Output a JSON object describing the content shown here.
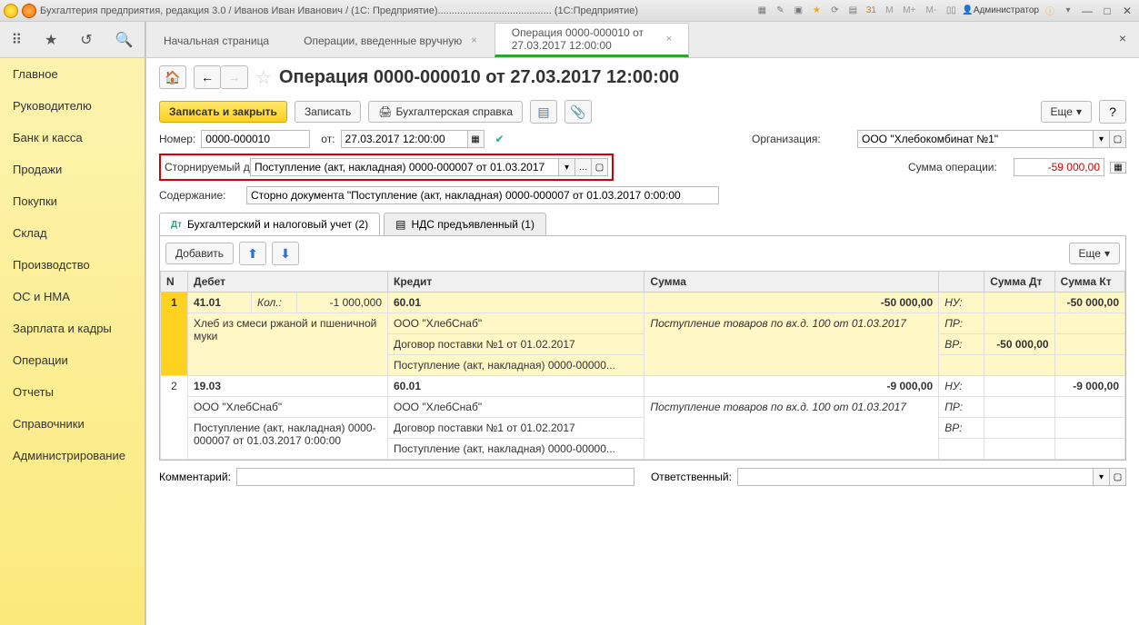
{
  "app": {
    "title": "Бухгалтерия предприятия, редакция 3.0 / Иванов Иван Иванович / (1С: Предприятие)......................................... (1С:Предприятие)",
    "user": "Администратор",
    "m_labels": [
      "M",
      "M+",
      "M-"
    ]
  },
  "sidebar": [
    "Главное",
    "Руководителю",
    "Банк и касса",
    "Продажи",
    "Покупки",
    "Склад",
    "Производство",
    "ОС и НМА",
    "Зарплата и кадры",
    "Операции",
    "Отчеты",
    "Справочники",
    "Администрирование"
  ],
  "tabs": {
    "start": "Начальная страница",
    "ops": "Операции, введенные вручную",
    "current": "Операция 0000-000010 от 27.03.2017 12:00:00"
  },
  "page": {
    "title": "Операция 0000-000010 от 27.03.2017 12:00:00",
    "save_close": "Записать и закрыть",
    "save": "Записать",
    "print": "Бухгалтерская справка",
    "more": "Еще"
  },
  "form": {
    "number_label": "Номер:",
    "number": "0000-000010",
    "from_label": "от:",
    "date": "27.03.2017 12:00:00",
    "org_label": "Организация:",
    "org_value": "ООО \"Хлебокомбинат №1\"",
    "storno_label": "Сторнируемый документ:",
    "storno_value": "Поступление (акт, накладная) 0000-000007 от 01.03.2017",
    "sum_label": "Сумма операции:",
    "sum_value": "-59 000,00",
    "desc_label": "Содержание:",
    "desc_value": "Сторно документа \"Поступление (акт, накладная) 0000-000007 от 01.03.2017 0:00:00"
  },
  "inner_tabs": {
    "acc": "Бухгалтерский и налоговый учет (2)",
    "vat": "НДС предъявленный (1)"
  },
  "table": {
    "add": "Добавить",
    "more": "Еще",
    "headers": {
      "n": "N",
      "debit": "Дебет",
      "credit": "Кредит",
      "sum": "Сумма",
      "sum_dt": "Сумма Дт",
      "sum_kt": "Сумма Кт"
    },
    "rows": [
      {
        "n": "1",
        "debit_acc": "41.01",
        "debit_qty_lbl": "Кол.:",
        "debit_qty": "-1 000,000",
        "debit_sub": [
          "Хлеб из смеси ржаной и пшеничной муки"
        ],
        "credit_acc": "60.01",
        "credit_sub": [
          "ООО \"ХлебСнаб\"",
          "Договор поставки №1 от 01.02.2017",
          "Поступление (акт, накладная) 0000-00000..."
        ],
        "sum": "-50 000,00",
        "sum_sub": [
          "Поступление товаров по вх.д. 100 от 01.03.2017"
        ],
        "du_labels": [
          "НУ:",
          "ПР:",
          "ВР:"
        ],
        "dt_vals": [
          "",
          "",
          "-50 000,00"
        ],
        "kt_vals": [
          "-50 000,00",
          "",
          ""
        ]
      },
      {
        "n": "2",
        "debit_acc": "19.03",
        "debit_sub": [
          "ООО \"ХлебСнаб\"",
          "Поступление (акт, накладная) 0000-000007 от 01.03.2017 0:00:00"
        ],
        "credit_acc": "60.01",
        "credit_sub": [
          "ООО \"ХлебСнаб\"",
          "Договор поставки №1 от 01.02.2017",
          "Поступление (акт, накладная) 0000-00000..."
        ],
        "sum": "-9 000,00",
        "sum_sub": [
          "Поступление товаров по вх.д. 100 от 01.03.2017"
        ],
        "du_labels": [
          "НУ:",
          "ПР:",
          "ВР:"
        ],
        "dt_vals": [
          "",
          "",
          ""
        ],
        "kt_vals": [
          "-9 000,00",
          "",
          ""
        ]
      }
    ]
  },
  "bottom": {
    "comment_label": "Комментарий:",
    "resp_label": "Ответственный:"
  }
}
